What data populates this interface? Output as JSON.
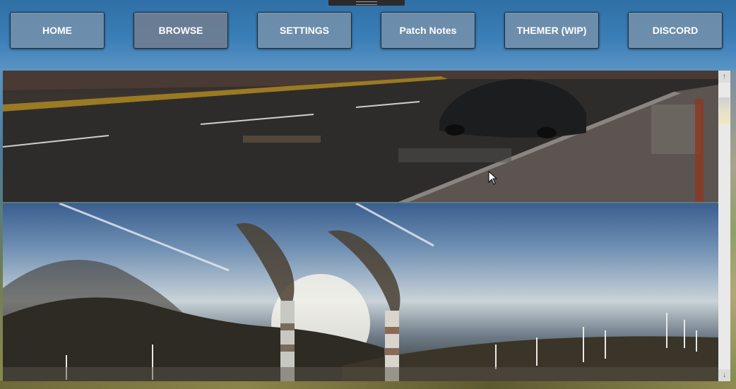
{
  "nav": {
    "home_label": "HOME",
    "browse_label": "BROWSE",
    "settings_label": "SETTINGS",
    "patch_notes_label": "Patch Notes",
    "themer_label": "THEMER (WIP)",
    "discord_label": "DISCORD"
  },
  "icons": {
    "scroll_up": "arrow-up-icon",
    "scroll_down": "arrow-down-icon",
    "cursor": "mouse-cursor-icon",
    "handle": "drag-handle-icon"
  },
  "colors": {
    "button_bg": "#7891aa",
    "button_border": "#1d2b38",
    "button_text": "#ffffff"
  }
}
